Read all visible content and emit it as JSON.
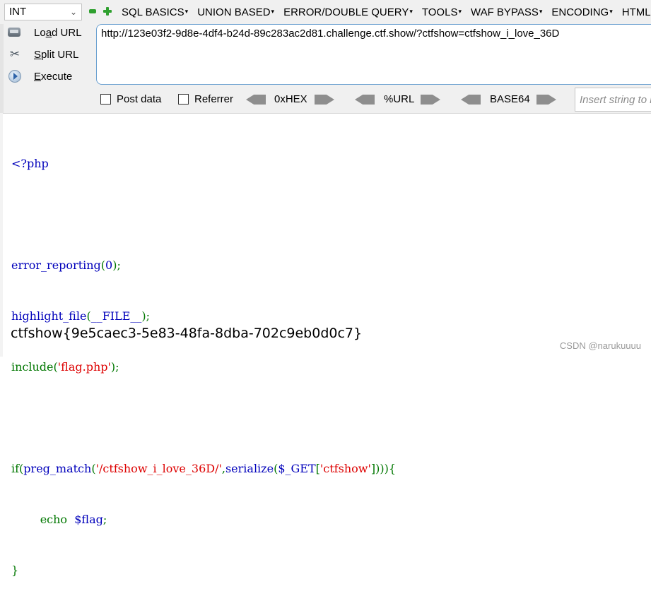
{
  "hackbar": {
    "mode_select": "INT",
    "menus": [
      "SQL BASICS",
      "UNION BASED",
      "ERROR/DOUBLE QUERY",
      "TOOLS",
      "WAF BYPASS",
      "ENCODING",
      "HTML"
    ],
    "actions": {
      "load_url": {
        "pre": "Lo",
        "key": "a",
        "post": "d URL"
      },
      "split_url": {
        "pre": "",
        "key": "S",
        "post": "plit URL"
      },
      "execute": {
        "pre": "",
        "key": "E",
        "post": "xecute"
      }
    },
    "url": "http://123e03f2-9d8e-4df4-b24d-89c283ac2d81.challenge.ctf.show/?ctfshow=ctfshow_i_love_36D",
    "options": {
      "post_data": "Post data",
      "referrer": "Referrer",
      "hex": "0xHEX",
      "url_enc": "%URL",
      "base64": "BASE64",
      "insert_placeholder": "Insert string to replace"
    }
  },
  "source_code": {
    "open_tag": "<?php",
    "line_error_fn": "error_reporting",
    "line_error_arg": "0",
    "line_highlight_fn": "highlight_file",
    "line_highlight_arg": "__FILE__",
    "line_include_fn": "include",
    "line_include_arg": "'flag.php'",
    "if_kw": "if",
    "preg_fn": "preg_match",
    "regex": "'/ctfshow_i_love_36D/'",
    "serialize_fn": "serialize",
    "get_var": "$_GET",
    "get_key": "'ctfshow'",
    "echo_kw": "echo",
    "flag_var": "$flag",
    "close_brace": "}"
  },
  "output": {
    "flag": "ctfshow{9e5caec3-5e83-48fa-8dba-702c9eb0d0c7}"
  },
  "watermark": "CSDN @narukuuuu",
  "colors": {
    "php_keyword": "#0000bb",
    "php_punct": "#007700",
    "php_string": "#dd0000",
    "hackbar_bg": "#f0f0f0",
    "url_border": "#6aa0d0"
  }
}
